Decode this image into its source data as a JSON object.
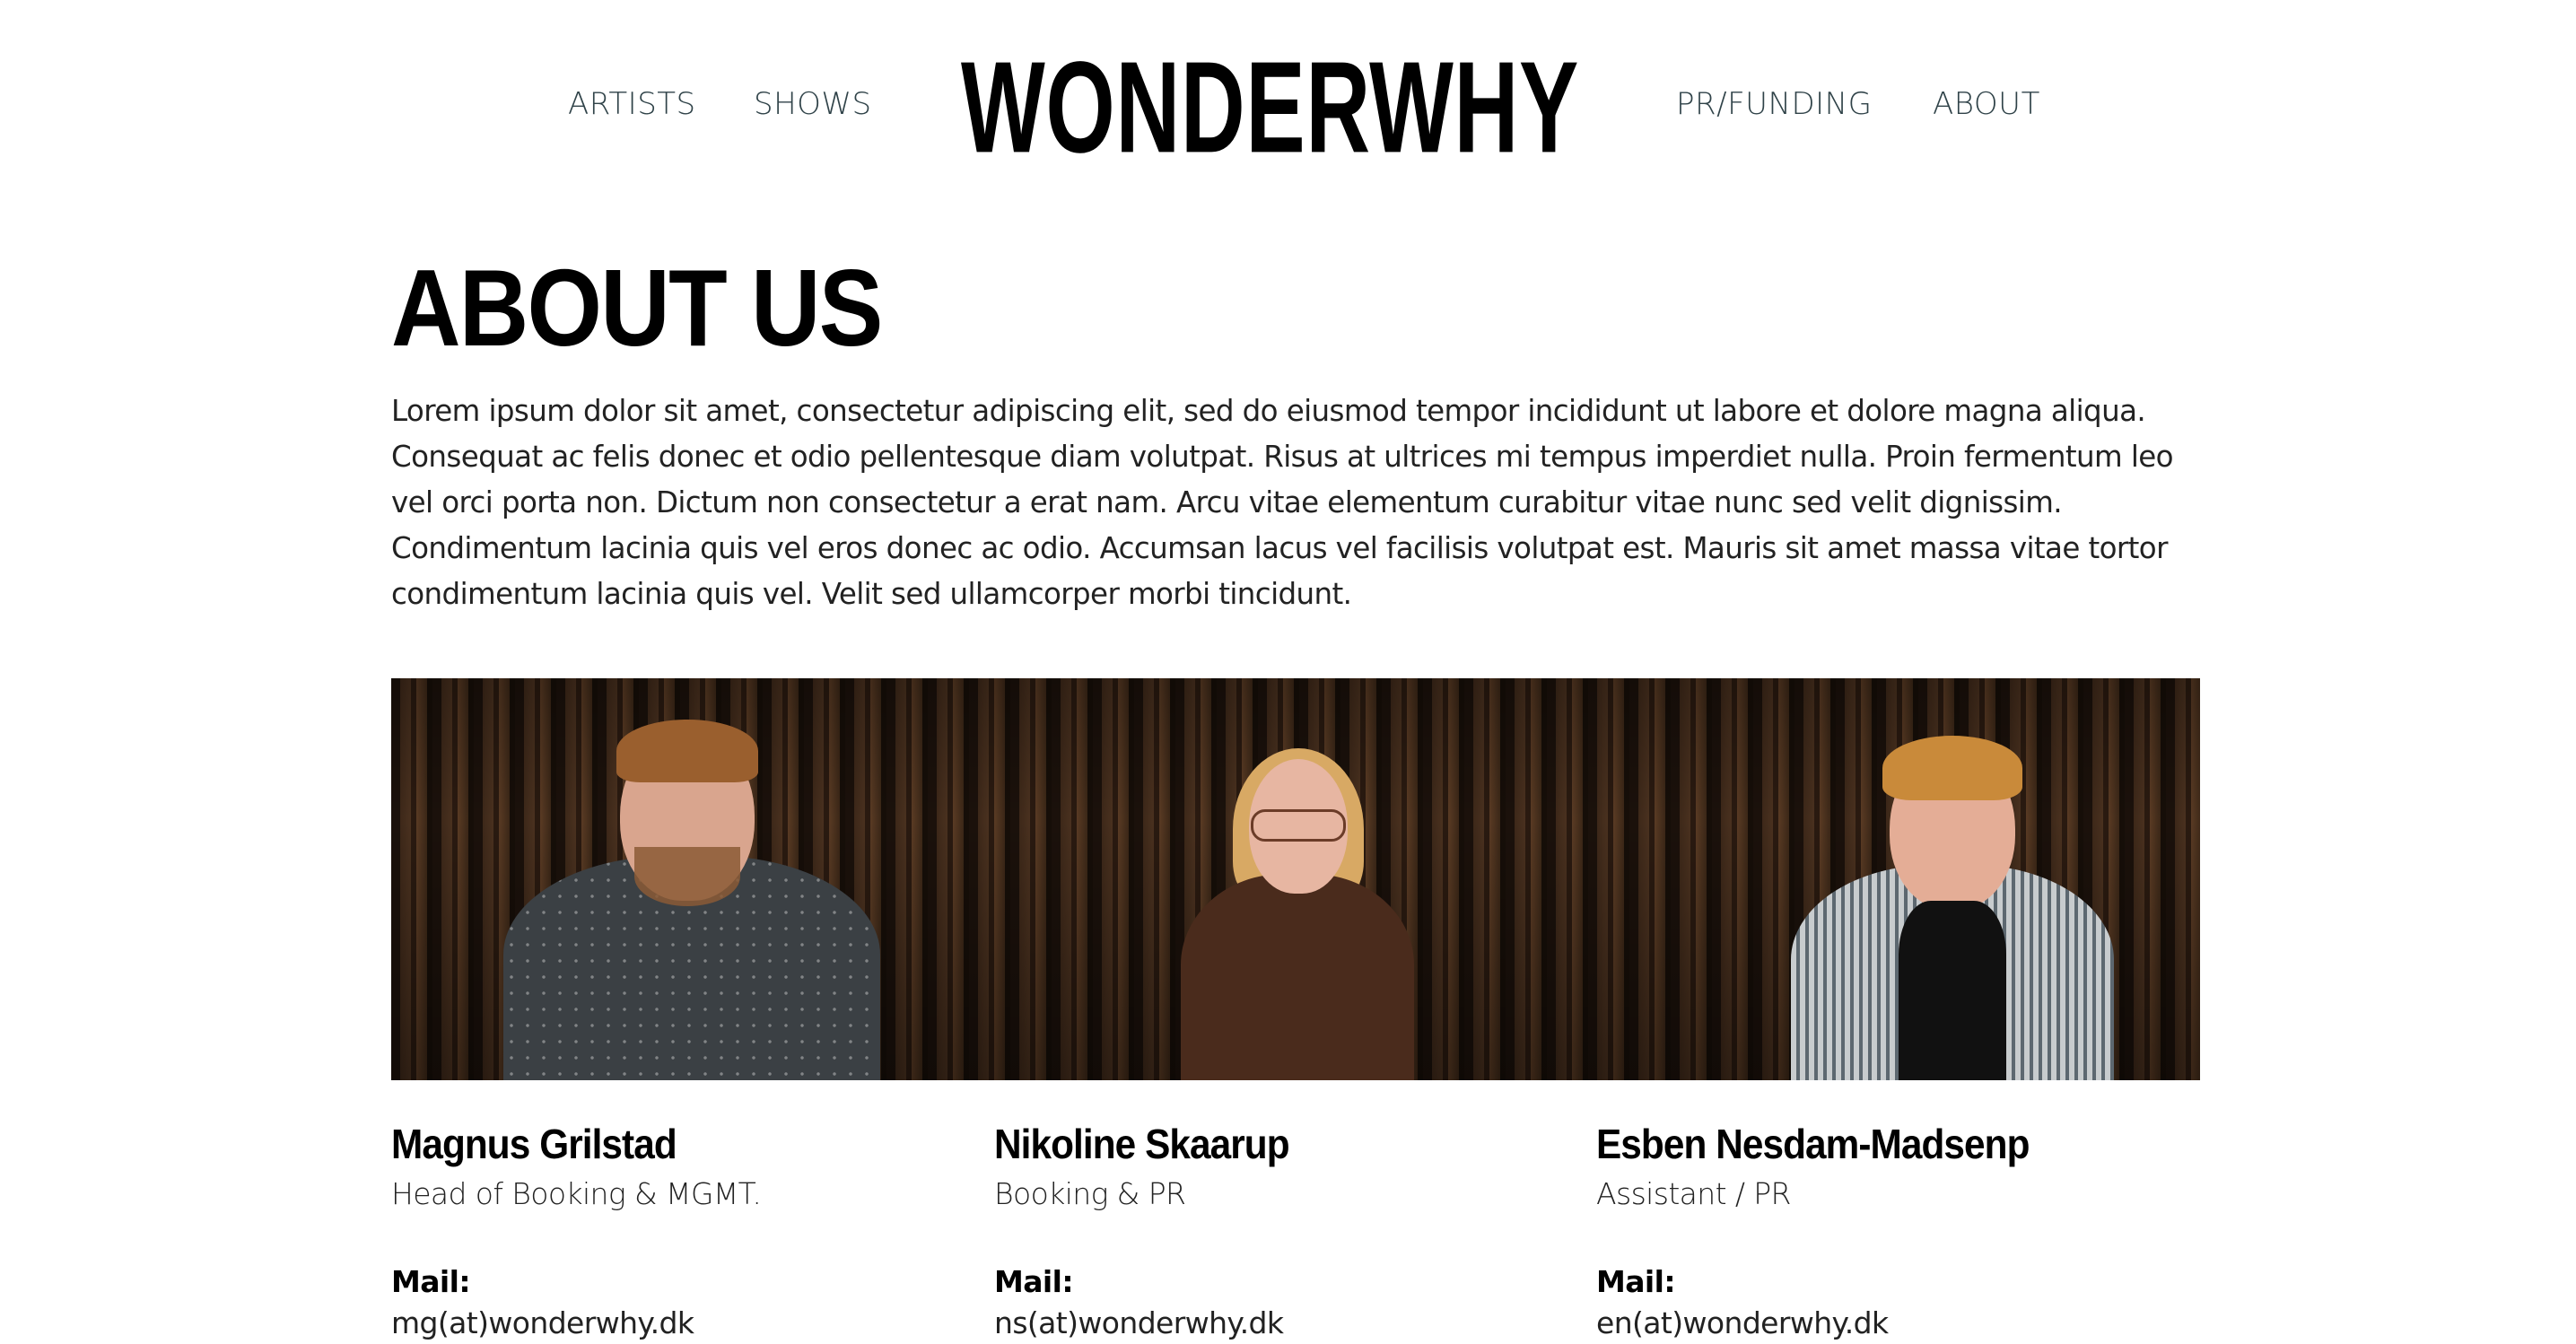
{
  "header": {
    "logo": "WONDERWHY",
    "nav": {
      "artists": "ARTISTS",
      "shows": "SHOWS",
      "pr_funding": "PR/FUNDING",
      "about": "ABOUT"
    }
  },
  "about": {
    "title": "ABOUT US",
    "intro": "Lorem ipsum dolor sit amet, consectetur adipiscing elit, sed do eiusmod tempor incididunt ut labore et dolore magna aliqua. Consequat ac felis donec et odio pellentesque diam volutpat. Risus at ultrices mi tempus imperdiet nulla. Proin fermentum leo vel orci porta non. Dictum non consectetur a erat nam. Arcu vitae elementum curabitur vitae nunc sed velit dignissim. Condimentum lacinia quis vel eros donec ac odio. Accumsan lacus vel facilisis volutpat est. Mauris sit amet massa vitae tortor condimentum lacinia quis vel. Velit sed ullamcorper morbi tincidunt."
  },
  "team": [
    {
      "name": "Magnus Grilstad",
      "role": "Head of Booking & MGMT.",
      "mail_label": "Mail:",
      "mail": "mg(at)wonderwhy.dk"
    },
    {
      "name": "Nikoline Skaarup",
      "role": "Booking & PR",
      "mail_label": "Mail:",
      "mail": "ns(at)wonderwhy.dk"
    },
    {
      "name": "Esben Nesdam-Madsenp",
      "role": "Assistant / PR",
      "mail_label": "Mail:",
      "mail": "en(at)wonderwhy.dk"
    }
  ],
  "colors": {
    "nav_text": "#2f4248",
    "heading": "#000000",
    "body_text": "#222222",
    "photo_backdrop": "#2a1a10"
  }
}
